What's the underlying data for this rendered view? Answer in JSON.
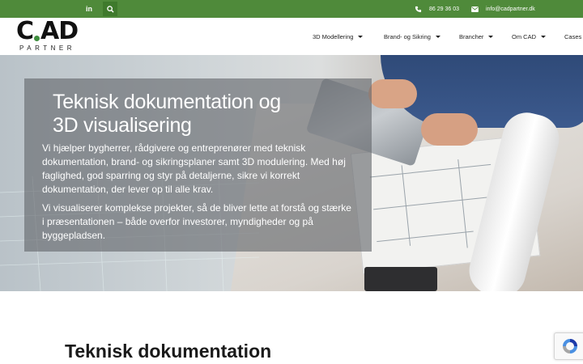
{
  "topbar": {
    "linkedin_icon": "linkedin-icon",
    "search_icon": "search-icon",
    "phone": "86 29 36 03",
    "email": "info@cadpartner.dk"
  },
  "logo": {
    "main": "C.AD",
    "main_left": "C",
    "main_right": "AD",
    "sub": "PARTNER"
  },
  "nav": {
    "items": [
      {
        "label": "3D Modellering"
      },
      {
        "label": "Brand- og Sikring"
      },
      {
        "label": "Brancher"
      },
      {
        "label": "Om CAD"
      },
      {
        "label": "Cases"
      }
    ]
  },
  "hero": {
    "title": "Teknisk dokumentation og 3D visualisering",
    "paragraph1": "Vi hjælper bygherrer, rådgivere og entreprenører med teknisk dokumentation, brand- og sikringsplaner samt 3D modulering. Med høj faglighed, god sparring og styr på detaljerne, sikre vi korrekt dokumentation, der lever op til alle krav.",
    "paragraph2": "Vi visualiserer komplekse projekter, så de bliver lette at forstå og stærke i præsentationen – både overfor investorer, myndigheder og på byggepladsen."
  },
  "section": {
    "title": "Teknisk dokumentation"
  },
  "colors": {
    "brand_green": "#4f8a3a",
    "dot_green": "#3f8f3f",
    "panel": "#62666a"
  }
}
